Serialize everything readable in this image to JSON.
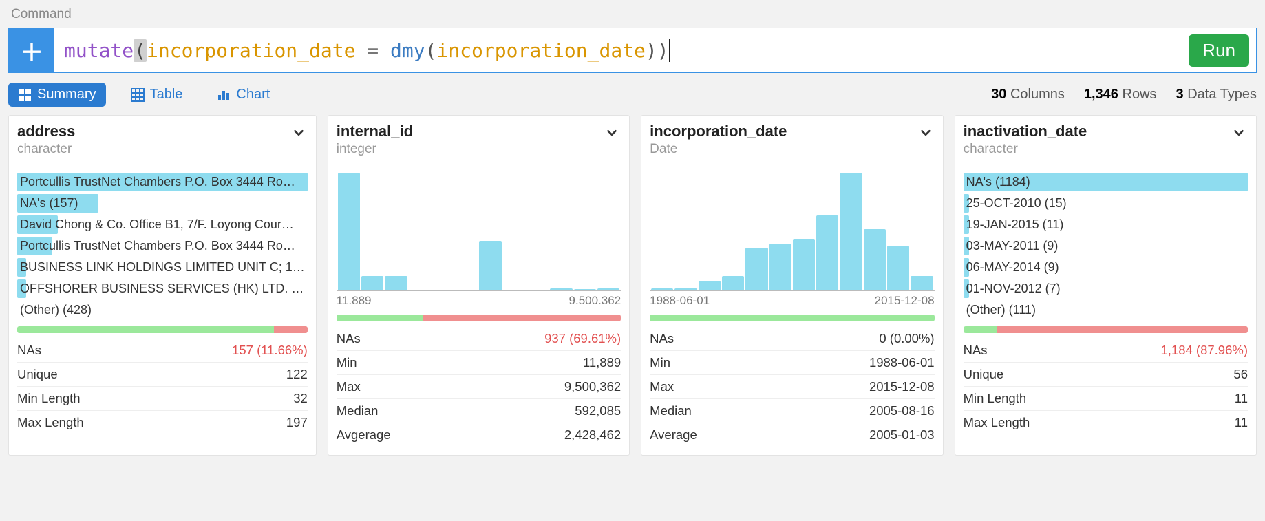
{
  "commandLabel": "Command",
  "cmd": {
    "key": "mutate",
    "ident1": "incorporation_date",
    "op": " = ",
    "func": "dmy",
    "ident2": "incorporation_date"
  },
  "runLabel": "Run",
  "tabs": {
    "summary": "Summary",
    "table": "Table",
    "chart": "Chart",
    "active": "summary"
  },
  "meta": {
    "columns": "30",
    "columnsLabel": " Columns",
    "rows": "1,346",
    "rowsLabel": " Rows",
    "types": "3",
    "typesLabel": " Data Types"
  },
  "cards": [
    {
      "title": "address",
      "type": "character",
      "kind": "freq",
      "items": [
        {
          "label": "Portcullis TrustNet Chambers P.O. Box 3444 Ro…",
          "pct": 100
        },
        {
          "label": "NA's (157)",
          "pct": 28
        },
        {
          "label": "David Chong & Co. Office B1, 7/F. Loyong Cour…",
          "pct": 14
        },
        {
          "label": "Portcullis TrustNet Chambers P.O. Box 3444 Ro…",
          "pct": 12
        },
        {
          "label": "BUSINESS LINK HOLDINGS LIMITED UNIT C; 1…",
          "pct": 3
        },
        {
          "label": "OFFSHORER BUSINESS SERVICES (HK) LTD. …",
          "pct": 3
        },
        {
          "label": "(Other) (428)",
          "pct": 0
        }
      ],
      "naOkPct": 88.34,
      "naNaPct": 11.66,
      "stats": [
        {
          "k": "NAs",
          "v": "157 (11.66%)",
          "red": true
        },
        {
          "k": "Unique",
          "v": "122"
        },
        {
          "k": "Min Length",
          "v": "32"
        },
        {
          "k": "Max Length",
          "v": "197"
        }
      ]
    },
    {
      "title": "internal_id",
      "type": "integer",
      "kind": "hist",
      "histHeights": [
        100,
        12,
        12,
        0,
        0,
        0,
        42,
        0,
        0,
        2,
        1,
        2
      ],
      "histMin": "11.889",
      "histMax": "9.500.362",
      "naOkPct": 30.39,
      "naNaPct": 69.61,
      "stats": [
        {
          "k": "NAs",
          "v": "937 (69.61%)",
          "red": true
        },
        {
          "k": "Min",
          "v": "11,889"
        },
        {
          "k": "Max",
          "v": "9,500,362"
        },
        {
          "k": "Median",
          "v": "592,085"
        },
        {
          "k": "Avgerage",
          "v": "2,428,462"
        }
      ]
    },
    {
      "title": "incorporation_date",
      "type": "Date",
      "kind": "hist",
      "histHeights": [
        2,
        2,
        8,
        12,
        36,
        40,
        44,
        64,
        100,
        52,
        38,
        12
      ],
      "histMin": "1988-06-01",
      "histMax": "2015-12-08",
      "naOkPct": 100,
      "naNaPct": 0,
      "stats": [
        {
          "k": "NAs",
          "v": "0 (0.00%)"
        },
        {
          "k": "Min",
          "v": "1988-06-01"
        },
        {
          "k": "Max",
          "v": "2015-12-08"
        },
        {
          "k": "Median",
          "v": "2005-08-16"
        },
        {
          "k": "Average",
          "v": "2005-01-03"
        }
      ]
    },
    {
      "title": "inactivation_date",
      "type": "character",
      "kind": "freq",
      "items": [
        {
          "label": "NA's (1184)",
          "pct": 100
        },
        {
          "label": "25-OCT-2010 (15)",
          "pct": 2
        },
        {
          "label": "19-JAN-2015 (11)",
          "pct": 2
        },
        {
          "label": "03-MAY-2011 (9)",
          "pct": 2
        },
        {
          "label": "06-MAY-2014 (9)",
          "pct": 2
        },
        {
          "label": "01-NOV-2012 (7)",
          "pct": 2
        },
        {
          "label": "(Other) (111)",
          "pct": 0
        }
      ],
      "naOkPct": 12.04,
      "naNaPct": 87.96,
      "stats": [
        {
          "k": "NAs",
          "v": "1,184 (87.96%)",
          "red": true
        },
        {
          "k": "Unique",
          "v": "56"
        },
        {
          "k": "Min Length",
          "v": "11"
        },
        {
          "k": "Max Length",
          "v": "11"
        }
      ]
    }
  ],
  "chart_data": [
    {
      "type": "table",
      "title": "address (character) top values",
      "series": [
        {
          "name": "count_proxy_width_pct",
          "values": [
            100,
            28,
            14,
            12,
            3,
            3
          ]
        }
      ],
      "categories": [
        "Portcullis TrustNet Chambers P.O. Box 3444 Ro…",
        "NA's (157)",
        "David Chong & Co. Office B1, 7/F. Loyong Cour…",
        "Portcullis TrustNet Chambers P.O. Box 3444 Ro…",
        "BUSINESS LINK HOLDINGS LIMITED UNIT C; 1…",
        "OFFSHORER BUSINESS SERVICES (HK) LTD. …"
      ],
      "notes": "(Other) 428"
    },
    {
      "type": "bar",
      "title": "internal_id histogram",
      "x_range": [
        "11.889",
        "9.500.362"
      ],
      "values_relative": [
        100,
        12,
        12,
        0,
        0,
        0,
        42,
        0,
        0,
        2,
        1,
        2
      ]
    },
    {
      "type": "bar",
      "title": "incorporation_date histogram",
      "x_range": [
        "1988-06-01",
        "2015-12-08"
      ],
      "values_relative": [
        2,
        2,
        8,
        12,
        36,
        40,
        44,
        64,
        100,
        52,
        38,
        12
      ]
    },
    {
      "type": "table",
      "title": "inactivation_date (character) top values",
      "series": [
        {
          "name": "count",
          "values": [
            1184,
            15,
            11,
            9,
            9,
            7
          ]
        }
      ],
      "categories": [
        "NA's",
        "25-OCT-2010",
        "19-JAN-2015",
        "03-MAY-2011",
        "06-MAY-2014",
        "01-NOV-2012"
      ],
      "notes": "(Other) 111"
    }
  ]
}
